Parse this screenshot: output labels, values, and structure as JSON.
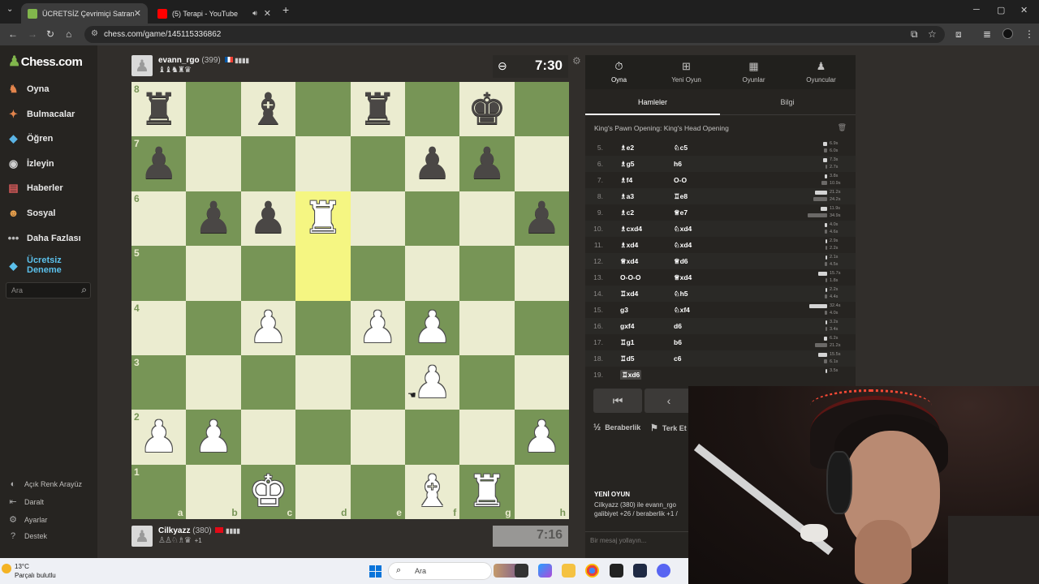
{
  "browser": {
    "tabs": [
      {
        "title": "ÜCRETSİZ Çevrimiçi Satranç Oy",
        "active": true,
        "favicon_color": "#81b64c"
      },
      {
        "title": "(5) Terapi - YouTube",
        "active": false,
        "favicon_color": "#ff0000"
      }
    ],
    "url": "chess.com/game/145115336862"
  },
  "sidebar": {
    "logo": "Chess.com",
    "items": [
      {
        "label": "Oyna",
        "icon": "play-icon"
      },
      {
        "label": "Bulmacalar",
        "icon": "puzzle-icon"
      },
      {
        "label": "Öğren",
        "icon": "learn-icon"
      },
      {
        "label": "İzleyin",
        "icon": "watch-icon"
      },
      {
        "label": "Haberler",
        "icon": "news-icon"
      },
      {
        "label": "Sosyal",
        "icon": "social-icon"
      },
      {
        "label": "Daha Fazlası",
        "icon": "more-icon"
      }
    ],
    "trial_line1": "Ücretsiz",
    "trial_line2": "Deneme",
    "search_placeholder": "Ara",
    "bottom": [
      {
        "label": "Açık Renk Arayüz",
        "icon": "theme-icon"
      },
      {
        "label": "Daralt",
        "icon": "collapse-icon"
      },
      {
        "label": "Ayarlar",
        "icon": "settings-icon"
      },
      {
        "label": "Destek",
        "icon": "help-icon"
      }
    ]
  },
  "opponent": {
    "name": "evann_rgo",
    "rating": "(399)",
    "captured": "♝♝♞♜♛",
    "clock": "7:30"
  },
  "player": {
    "name": "Cilkyazz",
    "rating": "(380)",
    "captured": "♙♙♘♗♛",
    "advantage": "+1",
    "clock": "7:16"
  },
  "board": {
    "files": [
      "a",
      "b",
      "c",
      "d",
      "e",
      "f",
      "g",
      "h"
    ],
    "ranks": [
      "8",
      "7",
      "6",
      "5",
      "4",
      "3",
      "2",
      "1"
    ],
    "light_color": "#ebecd0",
    "dark_color": "#779556",
    "highlight": [
      "d6",
      "d5"
    ],
    "pieces": [
      {
        "sq": "a8",
        "glyph": "♜",
        "side": "b"
      },
      {
        "sq": "c8",
        "glyph": "♝",
        "side": "b"
      },
      {
        "sq": "e8",
        "glyph": "♜",
        "side": "b"
      },
      {
        "sq": "g8",
        "glyph": "♚",
        "side": "b"
      },
      {
        "sq": "a7",
        "glyph": "♟",
        "side": "b"
      },
      {
        "sq": "f7",
        "glyph": "♟",
        "side": "b"
      },
      {
        "sq": "g7",
        "glyph": "♟",
        "side": "b"
      },
      {
        "sq": "b6",
        "glyph": "♟",
        "side": "b"
      },
      {
        "sq": "c6",
        "glyph": "♟",
        "side": "b"
      },
      {
        "sq": "d6",
        "glyph": "♜",
        "side": "w"
      },
      {
        "sq": "h6",
        "glyph": "♟",
        "side": "b"
      },
      {
        "sq": "c4",
        "glyph": "♟",
        "side": "w"
      },
      {
        "sq": "e4",
        "glyph": "♟",
        "side": "w"
      },
      {
        "sq": "f4",
        "glyph": "♟",
        "side": "w"
      },
      {
        "sq": "f3",
        "glyph": "♟",
        "side": "w"
      },
      {
        "sq": "a2",
        "glyph": "♟",
        "side": "w"
      },
      {
        "sq": "b2",
        "glyph": "♟",
        "side": "w"
      },
      {
        "sq": "h2",
        "glyph": "♟",
        "side": "w"
      },
      {
        "sq": "c1",
        "glyph": "♚",
        "side": "w"
      },
      {
        "sq": "f1",
        "glyph": "♝",
        "side": "w"
      },
      {
        "sq": "g1",
        "glyph": "♜",
        "side": "w"
      }
    ]
  },
  "panel": {
    "tabs": [
      {
        "label": "Oyna",
        "icon": "stopwatch-icon",
        "active": true
      },
      {
        "label": "Yeni Oyun",
        "icon": "plus-icon",
        "active": false
      },
      {
        "label": "Oyunlar",
        "icon": "board-icon",
        "active": false
      },
      {
        "label": "Oyuncular",
        "icon": "players-icon",
        "active": false
      }
    ],
    "subtabs": [
      {
        "label": "Hamleler",
        "active": true
      },
      {
        "label": "Bilgi",
        "active": false
      }
    ],
    "opening": "King's Pawn Opening: King's Head Opening",
    "moves": [
      {
        "n": "5.",
        "w": "♗e2",
        "b": "♘c5",
        "tw": "6.9s",
        "tb": "6.0s",
        "bw": 0.16,
        "bb": 0.14
      },
      {
        "n": "6.",
        "w": "♗g5",
        "b": "h6",
        "tw": "7.3s",
        "tb": "2.7s",
        "bw": 0.17,
        "bb": 0.06
      },
      {
        "n": "7.",
        "w": "♗f4",
        "b": "O-O",
        "tw": "3.8s",
        "tb": "10.9s",
        "bw": 0.09,
        "bb": 0.25
      },
      {
        "n": "8.",
        "w": "♗a3",
        "b": "♖e8",
        "tw": "21.2s",
        "tb": "24.2s",
        "bw": 0.49,
        "bb": 0.56
      },
      {
        "n": "9.",
        "w": "♗c2",
        "b": "♕e7",
        "tw": "11.9s",
        "tb": "34.9s",
        "bw": 0.28,
        "bb": 0.81
      },
      {
        "n": "10.",
        "w": "♗cxd4",
        "b": "♘xd4",
        "tw": "4.0s",
        "tb": "4.6s",
        "bw": 0.09,
        "bb": 0.11
      },
      {
        "n": "11.",
        "w": "♗xd4",
        "b": "♘xd4",
        "tw": "2.9s",
        "tb": "2.2s",
        "bw": 0.07,
        "bb": 0.05
      },
      {
        "n": "12.",
        "w": "♕xd4",
        "b": "♕d6",
        "tw": "2.1s",
        "tb": "4.5s",
        "bw": 0.05,
        "bb": 0.1
      },
      {
        "n": "13.",
        "w": "O-O-O",
        "b": "♕xd4",
        "tw": "15.7s",
        "tb": "1.8s",
        "bw": 0.36,
        "bb": 0.04
      },
      {
        "n": "14.",
        "w": "♖xd4",
        "b": "♘h5",
        "tw": "2.2s",
        "tb": "4.4s",
        "bw": 0.05,
        "bb": 0.1
      },
      {
        "n": "15.",
        "w": "g3",
        "b": "♘xf4",
        "tw": "32.4s",
        "tb": "4.0s",
        "bw": 0.75,
        "bb": 0.09
      },
      {
        "n": "16.",
        "w": "gxf4",
        "b": "d6",
        "tw": "3.2s",
        "tb": "3.4s",
        "bw": 0.07,
        "bb": 0.08
      },
      {
        "n": "17.",
        "w": "♖g1",
        "b": "b6",
        "tw": "6.2s",
        "tb": "21.2s",
        "bw": 0.14,
        "bb": 0.49
      },
      {
        "n": "18.",
        "w": "♖d5",
        "b": "c6",
        "tw": "15.5s",
        "tb": "6.1s",
        "bw": 0.36,
        "bb": 0.14
      },
      {
        "n": "19.",
        "w": "♖xd6",
        "b": "",
        "tw": "3.5s",
        "tb": "",
        "bw": 0.08,
        "bb": 0
      }
    ],
    "controls": [
      "⏮",
      "‹"
    ],
    "draw_label": "Beraberlik",
    "draw_icon": "½",
    "resign_label": "Terk Et",
    "chat_header": "YENİ OYUN",
    "chat_line1": "Cilkyazz (380) ile evann_rgo",
    "chat_line2": "galibiyet +26 / beraberlik +1 /",
    "chat_placeholder": "Bir mesaj yollayın..."
  },
  "taskbar": {
    "temp": "13°C",
    "weather": "Parçalı bulutlu",
    "search": "Ara"
  }
}
